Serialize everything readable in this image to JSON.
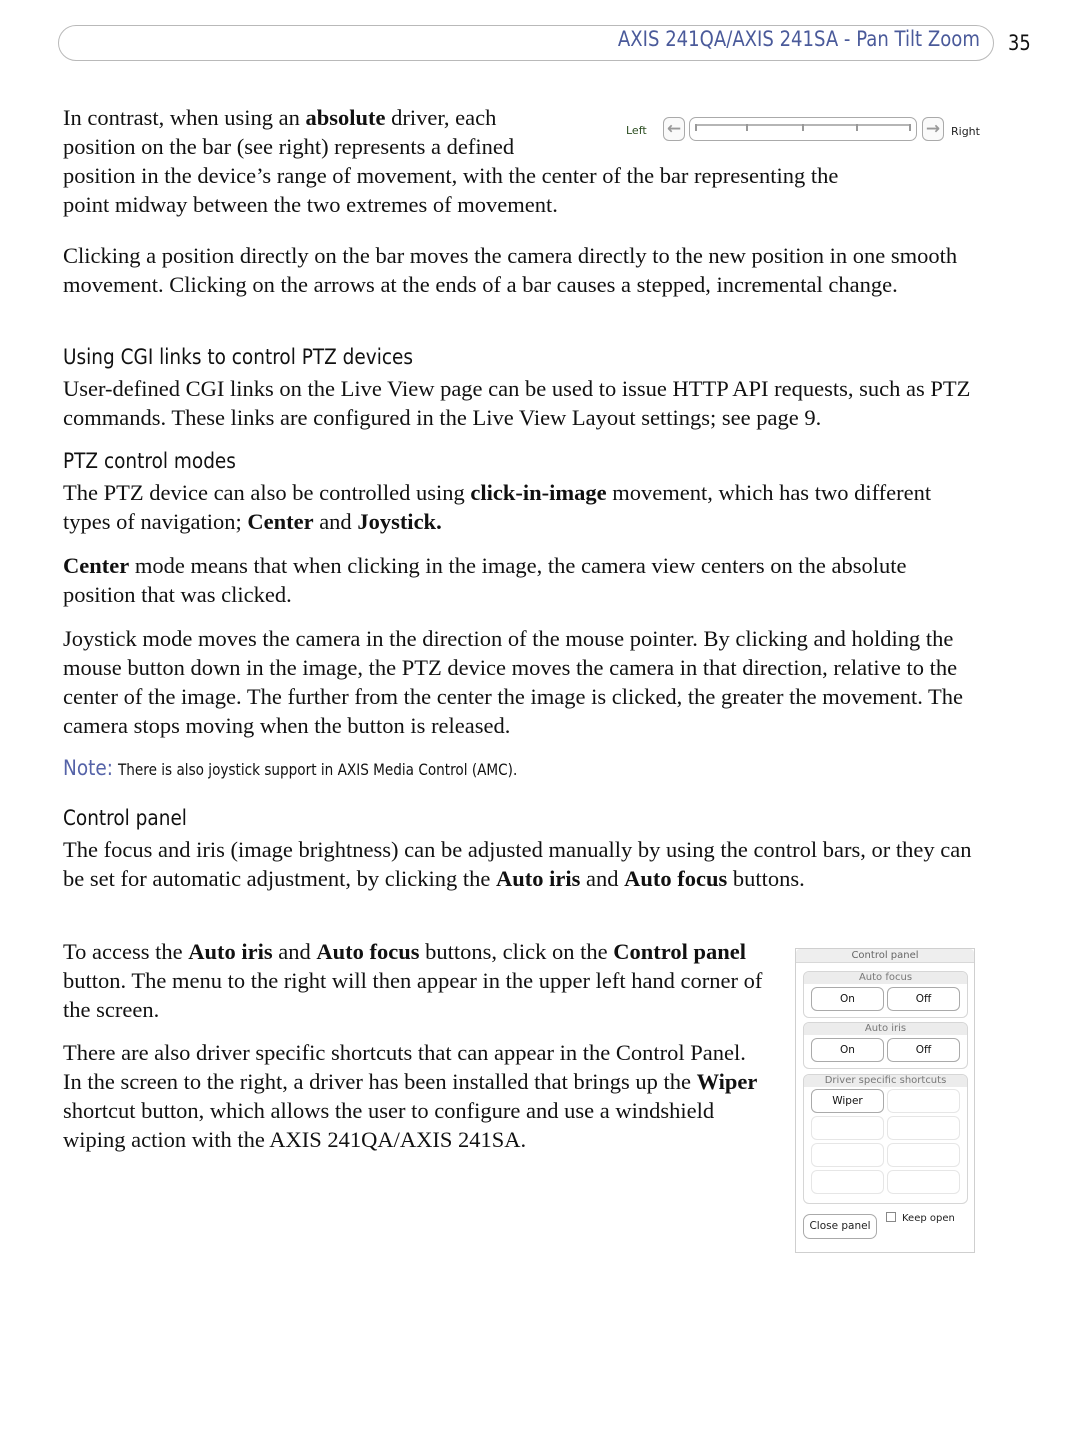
{
  "header": {
    "title": "AXIS 241QA/AXIS 241SA - Pan Tilt Zoom",
    "page_number": "35"
  },
  "intro": {
    "lines": [
      {
        "pre": "In contrast, when using an ",
        "bold": "absolute",
        "post": " driver, each"
      },
      {
        "text": "position on the bar (see right) represents a defined"
      },
      {
        "text": "position in the device’s range of movement, with the center of the bar representing the"
      },
      {
        "text": "point midway between the two extremes of movement."
      }
    ]
  },
  "clicking_paragraph": "Clicking a position directly on the bar moves the camera directly to the new position in one smooth movement. Clicking on the arrows at the ends of a bar causes a stepped, incremental change.",
  "sections": {
    "cgi": {
      "heading": "Using CGI links to control PTZ devices",
      "body": "User-defined CGI links on the Live View page can be used to issue HTTP API requests, such as PTZ commands. These links are configured in the Live View Layout settings; see page 9."
    },
    "modes": {
      "heading": "PTZ control modes",
      "p1_pre": "The PTZ device can also be controlled using ",
      "p1_bold": "click-in-image",
      "p1_mid": " movement, which has two different types of navigation; ",
      "p1_bold2": "Center",
      "p1_and": " and ",
      "p1_bold3": "Joystick.",
      "p2_bold": "Center",
      "p2_rest": " mode means that when clicking in the image, the camera view centers on the absolute position that was clicked.",
      "p3": "Joystick mode moves the camera in the direction of the mouse pointer. By clicking and holding the mouse button down in the image, the PTZ device moves the camera in that direction, relative to the center of the image. The further from the center the image is clicked, the greater the movement. The camera stops moving when the button is released."
    },
    "note": {
      "label": "Note:",
      "text": "There is also joystick support in AXIS Media Control (AMC)."
    },
    "control_panel": {
      "heading": "Control panel",
      "p1_a": "The focus and iris (image brightness) can be adjusted manually by using the control bars, or they can be set for automatic adjustment, by clicking the ",
      "p1_b1": "Auto iris",
      "p1_c": " and ",
      "p1_b2": "Auto focus",
      "p1_d": " buttons.",
      "p2_a": "To access the ",
      "p2_b1": "Auto iris",
      "p2_c": " and ",
      "p2_b2": "Auto focus",
      "p2_d": " buttons, click on the ",
      "p2_b3": "Control panel",
      "p2_e": " button. The menu to the right will then appear in the upper left hand corner of the screen.",
      "p3_a": "There are also driver specific shortcuts that can appear in the Control Panel. In the screen to the right, a driver has been installed that brings up the ",
      "p3_b": "Wiper",
      "p3_c": " shortcut button, which allows the user to configure and use a windshield wiping action with the AXIS 241QA/AXIS 241SA."
    }
  },
  "pan_bar": {
    "left_label": "Left",
    "right_label": "Right",
    "left_icon": "arrow-left-icon",
    "right_icon": "arrow-right-icon",
    "tick_count": 5
  },
  "control_panel_widget": {
    "title": "Control panel",
    "auto_focus": {
      "title": "Auto focus",
      "on": "On",
      "off": "Off"
    },
    "auto_iris": {
      "title": "Auto iris",
      "on": "On",
      "off": "Off"
    },
    "shortcuts": {
      "title": "Driver specific shortcuts",
      "buttons": [
        "Wiper"
      ]
    },
    "close_button": "Close panel",
    "keep_open_label": "Keep open",
    "keep_open_checked": false
  }
}
